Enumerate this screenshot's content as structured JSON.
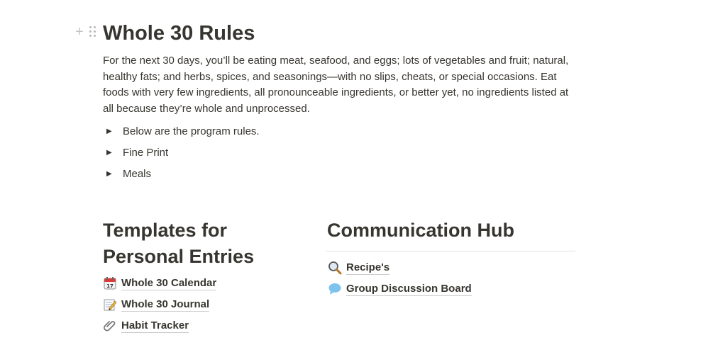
{
  "title": "Whole 30 Rules",
  "intro": "For the next 30 days, you’ll be eating meat, seafood, and eggs; lots of vegetables and fruit; natural, healthy fats; and herbs, spices, and seasonings—with no slips, cheats, or special occasions. Eat foods with very few ingredients, all pronounceable ingredients, or better yet, no ingredients listed at all because they’re whole and unprocessed.",
  "toggles": [
    {
      "label": "Below are the program rules."
    },
    {
      "label": "Fine Print"
    },
    {
      "label": "Meals"
    }
  ],
  "templates": {
    "heading": "Templates for Personal Entries",
    "items": [
      {
        "icon": "calendar-icon",
        "label": "Whole 30 Calendar"
      },
      {
        "icon": "memo-pencil-icon",
        "label": "Whole 30 Journal"
      },
      {
        "icon": "paperclip-icon",
        "label": "Habit Tracker"
      }
    ]
  },
  "communication": {
    "heading": "Communication Hub",
    "items": [
      {
        "icon": "magnifier-icon",
        "label": "Recipe's"
      },
      {
        "icon": "speech-bubble-icon",
        "label": "Group Discussion Board"
      }
    ]
  }
}
